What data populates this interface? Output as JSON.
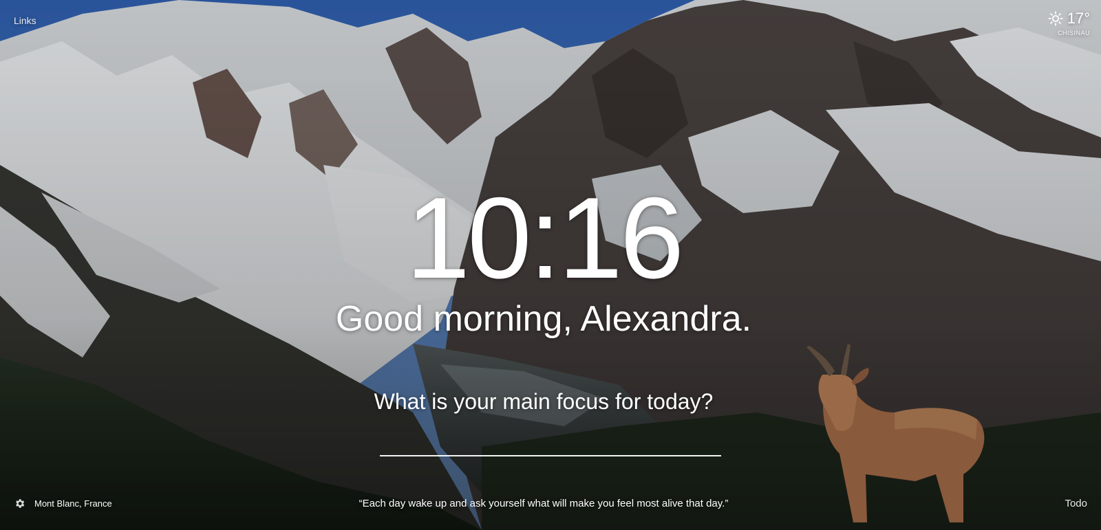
{
  "header": {
    "links_label": "Links"
  },
  "weather": {
    "icon": "sun-icon",
    "temperature": "17°",
    "location": "CHISINAU"
  },
  "main": {
    "time": "10:16",
    "greeting": "Good morning, Alexandra.",
    "focus_prompt": "What is your main focus for today?",
    "focus_value": ""
  },
  "footer": {
    "settings_icon": "gear-icon",
    "photo_location": "Mont Blanc, France",
    "quote": "“Each day wake up and ask yourself what will make you feel most alive that day.”",
    "todo_label": "Todo"
  },
  "colors": {
    "text": "#ffffff",
    "sky": "#3f6fb5",
    "snow": "#eef2f5",
    "rock": "#4a4340",
    "forest": "#233322",
    "goat": "#8a5a3c"
  }
}
